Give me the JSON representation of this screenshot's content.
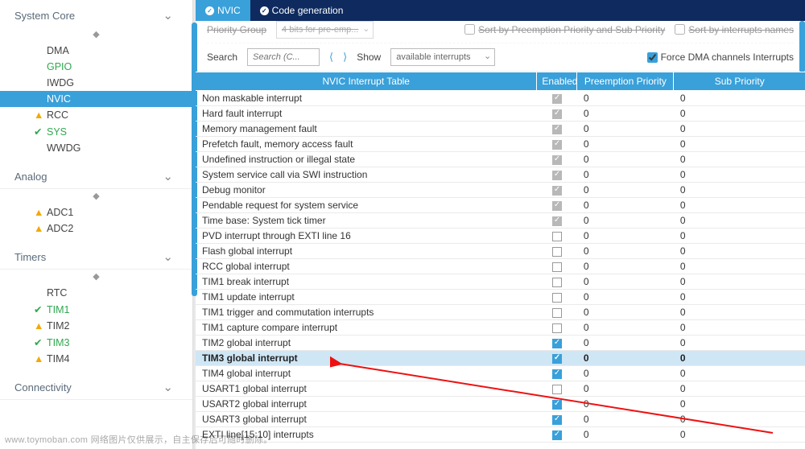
{
  "sidebar": {
    "categories": [
      {
        "label": "System Core",
        "items": [
          {
            "label": "DMA"
          },
          {
            "label": "GPIO",
            "green": true
          },
          {
            "label": "IWDG"
          },
          {
            "label": "NVIC",
            "selected": true
          },
          {
            "label": "RCC",
            "status": "warn"
          },
          {
            "label": "SYS",
            "status": "ok",
            "green": true
          },
          {
            "label": "WWDG"
          }
        ]
      },
      {
        "label": "Analog",
        "items": [
          {
            "label": "ADC1",
            "status": "warn"
          },
          {
            "label": "ADC2",
            "status": "warn"
          }
        ]
      },
      {
        "label": "Timers",
        "items": [
          {
            "label": "RTC"
          },
          {
            "label": "TIM1",
            "status": "ok",
            "green": true
          },
          {
            "label": "TIM2",
            "status": "warn"
          },
          {
            "label": "TIM3",
            "status": "ok",
            "green": true
          },
          {
            "label": "TIM4",
            "status": "warn"
          }
        ]
      },
      {
        "label": "Connectivity",
        "items": []
      }
    ]
  },
  "tabs": {
    "active": "NVIC",
    "inactive": "Code generation"
  },
  "toolbar": {
    "priority_group_label": "Priority Group",
    "priority_group_value": "4 bits for pre-emp...",
    "sort1": "Sort by Preemption Priority and Sub Priority",
    "sort2": "Sort by interrupts names",
    "search_label": "Search",
    "search_placeholder": "Search (C...",
    "show_label": "Show",
    "show_value": "available interrupts",
    "force_label": "Force DMA channels Interrupts"
  },
  "table": {
    "headers": [
      "NVIC Interrupt Table",
      "Enabled",
      "Preemption Priority",
      "Sub Priority"
    ],
    "rows": [
      {
        "name": "Non maskable interrupt",
        "enabled": true,
        "locked": true,
        "pre": "0",
        "sub": "0"
      },
      {
        "name": "Hard fault interrupt",
        "enabled": true,
        "locked": true,
        "pre": "0",
        "sub": "0"
      },
      {
        "name": "Memory management fault",
        "enabled": true,
        "locked": true,
        "pre": "0",
        "sub": "0"
      },
      {
        "name": "Prefetch fault, memory access fault",
        "enabled": true,
        "locked": true,
        "pre": "0",
        "sub": "0"
      },
      {
        "name": "Undefined instruction or illegal state",
        "enabled": true,
        "locked": true,
        "pre": "0",
        "sub": "0"
      },
      {
        "name": "System service call via SWI instruction",
        "enabled": true,
        "locked": true,
        "pre": "0",
        "sub": "0"
      },
      {
        "name": "Debug monitor",
        "enabled": true,
        "locked": true,
        "pre": "0",
        "sub": "0"
      },
      {
        "name": "Pendable request for system service",
        "enabled": true,
        "locked": true,
        "pre": "0",
        "sub": "0"
      },
      {
        "name": "Time base: System tick timer",
        "enabled": true,
        "locked": true,
        "pre": "0",
        "sub": "0"
      },
      {
        "name": "PVD interrupt through EXTI line 16",
        "enabled": false,
        "pre": "0",
        "sub": "0"
      },
      {
        "name": "Flash global interrupt",
        "enabled": false,
        "pre": "0",
        "sub": "0"
      },
      {
        "name": "RCC global interrupt",
        "enabled": false,
        "pre": "0",
        "sub": "0"
      },
      {
        "name": "TIM1 break interrupt",
        "enabled": false,
        "pre": "0",
        "sub": "0"
      },
      {
        "name": "TIM1 update interrupt",
        "enabled": false,
        "pre": "0",
        "sub": "0"
      },
      {
        "name": "TIM1 trigger and commutation interrupts",
        "enabled": false,
        "pre": "0",
        "sub": "0"
      },
      {
        "name": "TIM1 capture compare interrupt",
        "enabled": false,
        "pre": "0",
        "sub": "0"
      },
      {
        "name": "TIM2 global interrupt",
        "enabled": true,
        "pre": "0",
        "sub": "0"
      },
      {
        "name": "TIM3 global interrupt",
        "enabled": true,
        "pre": "0",
        "sub": "0",
        "highlight": true
      },
      {
        "name": "TIM4 global interrupt",
        "enabled": true,
        "pre": "0",
        "sub": "0"
      },
      {
        "name": "USART1 global interrupt",
        "enabled": false,
        "pre": "0",
        "sub": "0"
      },
      {
        "name": "USART2 global interrupt",
        "enabled": true,
        "pre": "0",
        "sub": "0"
      },
      {
        "name": "USART3 global interrupt",
        "enabled": true,
        "pre": "0",
        "sub": "0"
      },
      {
        "name": "EXTI line[15:10] interrupts",
        "enabled": true,
        "pre": "0",
        "sub": "0"
      }
    ]
  },
  "watermark": "www.toymoban.com 网络图片仅供展示，自主保存后可随时删除。"
}
